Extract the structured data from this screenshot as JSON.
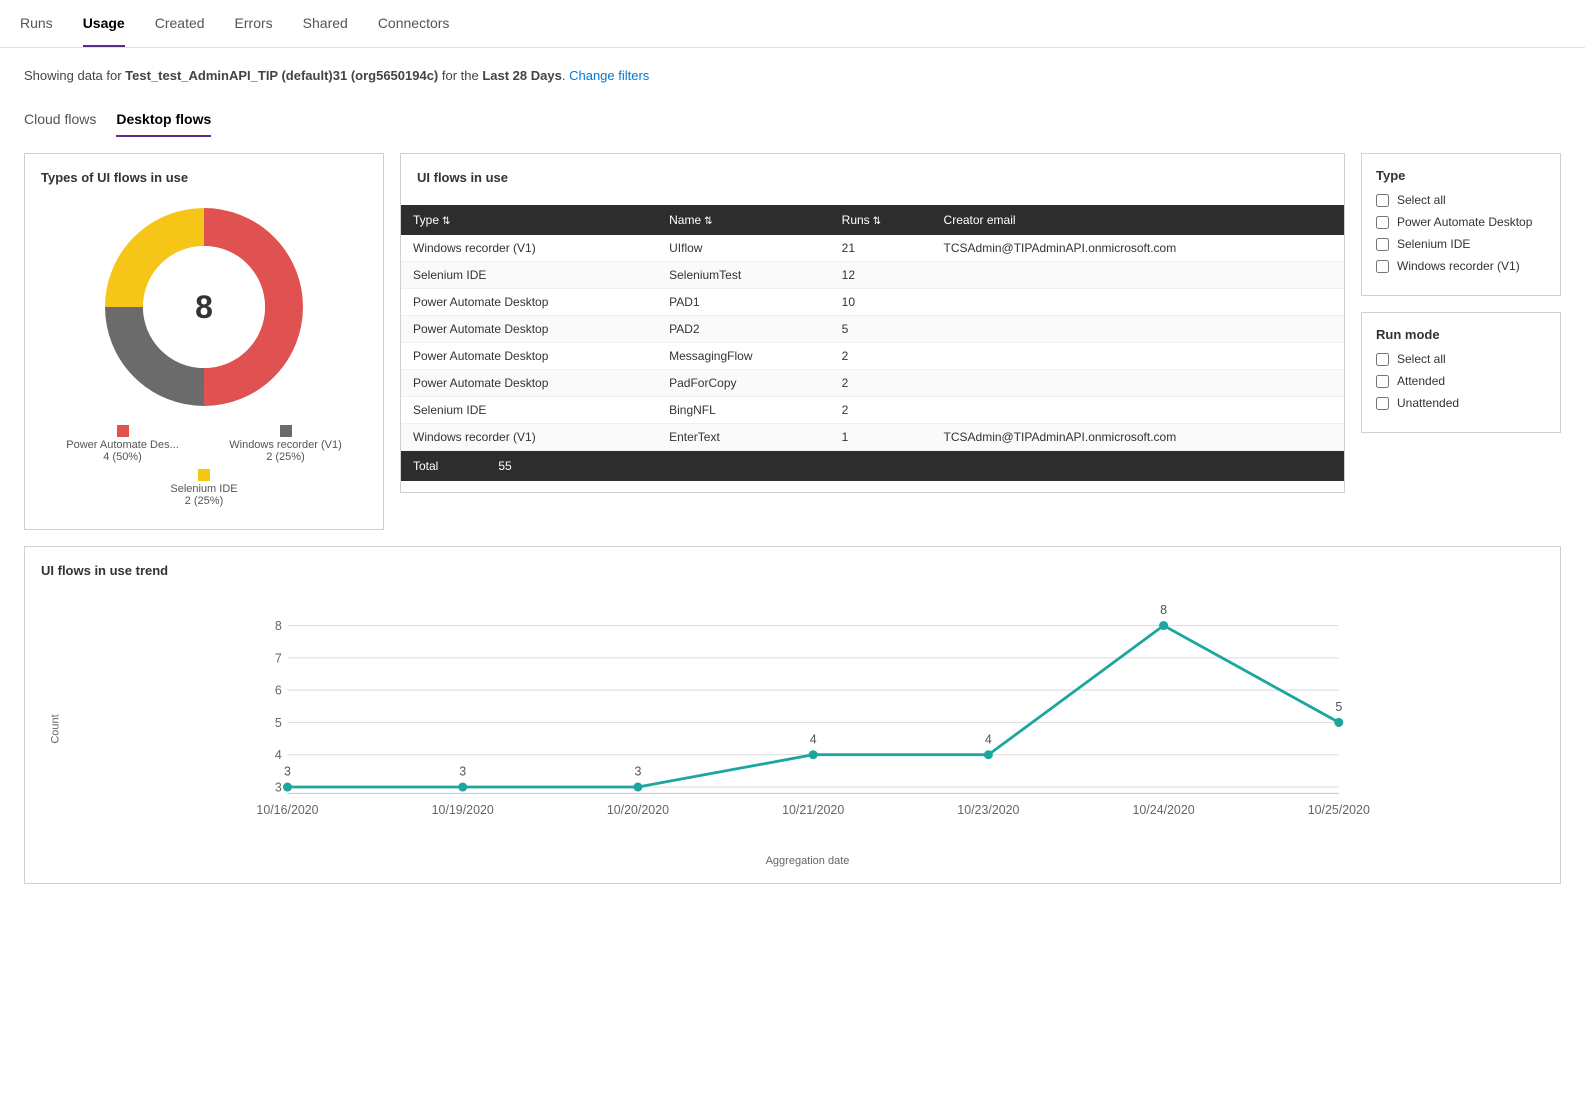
{
  "nav": {
    "items": [
      {
        "label": "Runs",
        "active": false
      },
      {
        "label": "Usage",
        "active": true
      },
      {
        "label": "Created",
        "active": false
      },
      {
        "label": "Errors",
        "active": false
      },
      {
        "label": "Shared",
        "active": false
      },
      {
        "label": "Connectors",
        "active": false
      }
    ]
  },
  "subtitle": {
    "prefix": "Showing data for ",
    "bold": "Test_test_AdminAPI_TIP (default)31 (org5650194c)",
    "middle": " for the ",
    "bold2": "Last 28 Days",
    "suffix": ".",
    "link": "Change filters"
  },
  "flowTabs": [
    {
      "label": "Cloud flows",
      "active": false
    },
    {
      "label": "Desktop flows",
      "active": true
    }
  ],
  "donutPanel": {
    "title": "Types of UI flows in use",
    "centerValue": "8",
    "segments": [
      {
        "label": "Power Automate Des...",
        "sublabel": "4 (50%)",
        "color": "#e05252",
        "percentage": 50
      },
      {
        "label": "Windows recorder (V1)",
        "sublabel": "2 (25%)",
        "color": "#6b6b6b",
        "percentage": 25
      },
      {
        "label": "Selenium IDE",
        "sublabel": "2 (25%)",
        "color": "#f5c518",
        "percentage": 25
      }
    ]
  },
  "tablePanel": {
    "title": "UI flows in use",
    "columns": [
      {
        "label": "Type",
        "sortable": true
      },
      {
        "label": "Name",
        "sortable": true
      },
      {
        "label": "Runs",
        "sortable": true
      },
      {
        "label": "Creator email",
        "sortable": false
      }
    ],
    "rows": [
      {
        "type": "Windows recorder (V1)",
        "name": "UIflow",
        "runs": "21",
        "email": "TCSAdmin@TIPAdminAPI.onmicrosoft.com"
      },
      {
        "type": "Selenium IDE",
        "name": "SeleniumTest",
        "runs": "12",
        "email": ""
      },
      {
        "type": "Power Automate Desktop",
        "name": "PAD1",
        "runs": "10",
        "email": ""
      },
      {
        "type": "Power Automate Desktop",
        "name": "PAD2",
        "runs": "5",
        "email": ""
      },
      {
        "type": "Power Automate Desktop",
        "name": "MessagingFlow",
        "runs": "2",
        "email": ""
      },
      {
        "type": "Power Automate Desktop",
        "name": "PadForCopy",
        "runs": "2",
        "email": ""
      },
      {
        "type": "Selenium IDE",
        "name": "BingNFL",
        "runs": "2",
        "email": ""
      },
      {
        "type": "Windows recorder (V1)",
        "name": "EnterText",
        "runs": "1",
        "email": "TCSAdmin@TIPAdminAPI.onmicrosoft.com"
      }
    ],
    "footer": {
      "label": "Total",
      "value": "55"
    }
  },
  "typeFilter": {
    "title": "Type",
    "items": [
      {
        "label": "Select all",
        "checked": false
      },
      {
        "label": "Power Automate Desktop",
        "checked": false
      },
      {
        "label": "Selenium IDE",
        "checked": false
      },
      {
        "label": "Windows recorder (V1)",
        "checked": false
      }
    ]
  },
  "runModeFilter": {
    "title": "Run mode",
    "items": [
      {
        "label": "Select all",
        "checked": false
      },
      {
        "label": "Attended",
        "checked": false
      },
      {
        "label": "Unattended",
        "checked": false
      }
    ]
  },
  "trendPanel": {
    "title": "UI flows in use trend",
    "yLabel": "Count",
    "xLabel": "Aggregation date",
    "yMax": 8,
    "yMin": 3,
    "dataPoints": [
      {
        "x": "10/16/2020",
        "y": 3
      },
      {
        "x": "10/19/2020",
        "y": 3
      },
      {
        "x": "10/20/2020",
        "y": 3
      },
      {
        "x": "10/21/2020",
        "y": 4
      },
      {
        "x": "10/23/2020",
        "y": 4
      },
      {
        "x": "10/24/2020",
        "y": 8
      },
      {
        "x": "10/25/2020",
        "y": 5
      }
    ],
    "yTicks": [
      3,
      4,
      5,
      6,
      7,
      8
    ],
    "lineColor": "#1da6a0"
  }
}
